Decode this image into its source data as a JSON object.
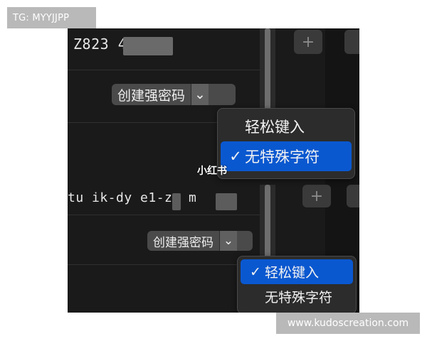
{
  "watermarks": {
    "top": "TG: MYYJJPP",
    "bottom": "www.kudoscreation.com",
    "xiaohongshu": "小红书"
  },
  "entry1": {
    "password_visible": "Z823          48qEz",
    "create_button_label": "创建强密码",
    "menu": [
      {
        "label": "轻松键入",
        "selected": false
      },
      {
        "label": "无特殊字符",
        "selected": true
      }
    ]
  },
  "entry2": {
    "password_visible": "tu  ik-dy   e1-zy    m",
    "create_button_label": "创建强密码",
    "menu": [
      {
        "label": "轻松键入",
        "selected": true
      },
      {
        "label": "无特殊字符",
        "selected": false
      }
    ]
  },
  "icons": {
    "plus": "+",
    "check": "✓",
    "chevron": "⌄"
  },
  "colors": {
    "selection": "#0a58d0",
    "panel_bg": "#1a1a1a"
  }
}
